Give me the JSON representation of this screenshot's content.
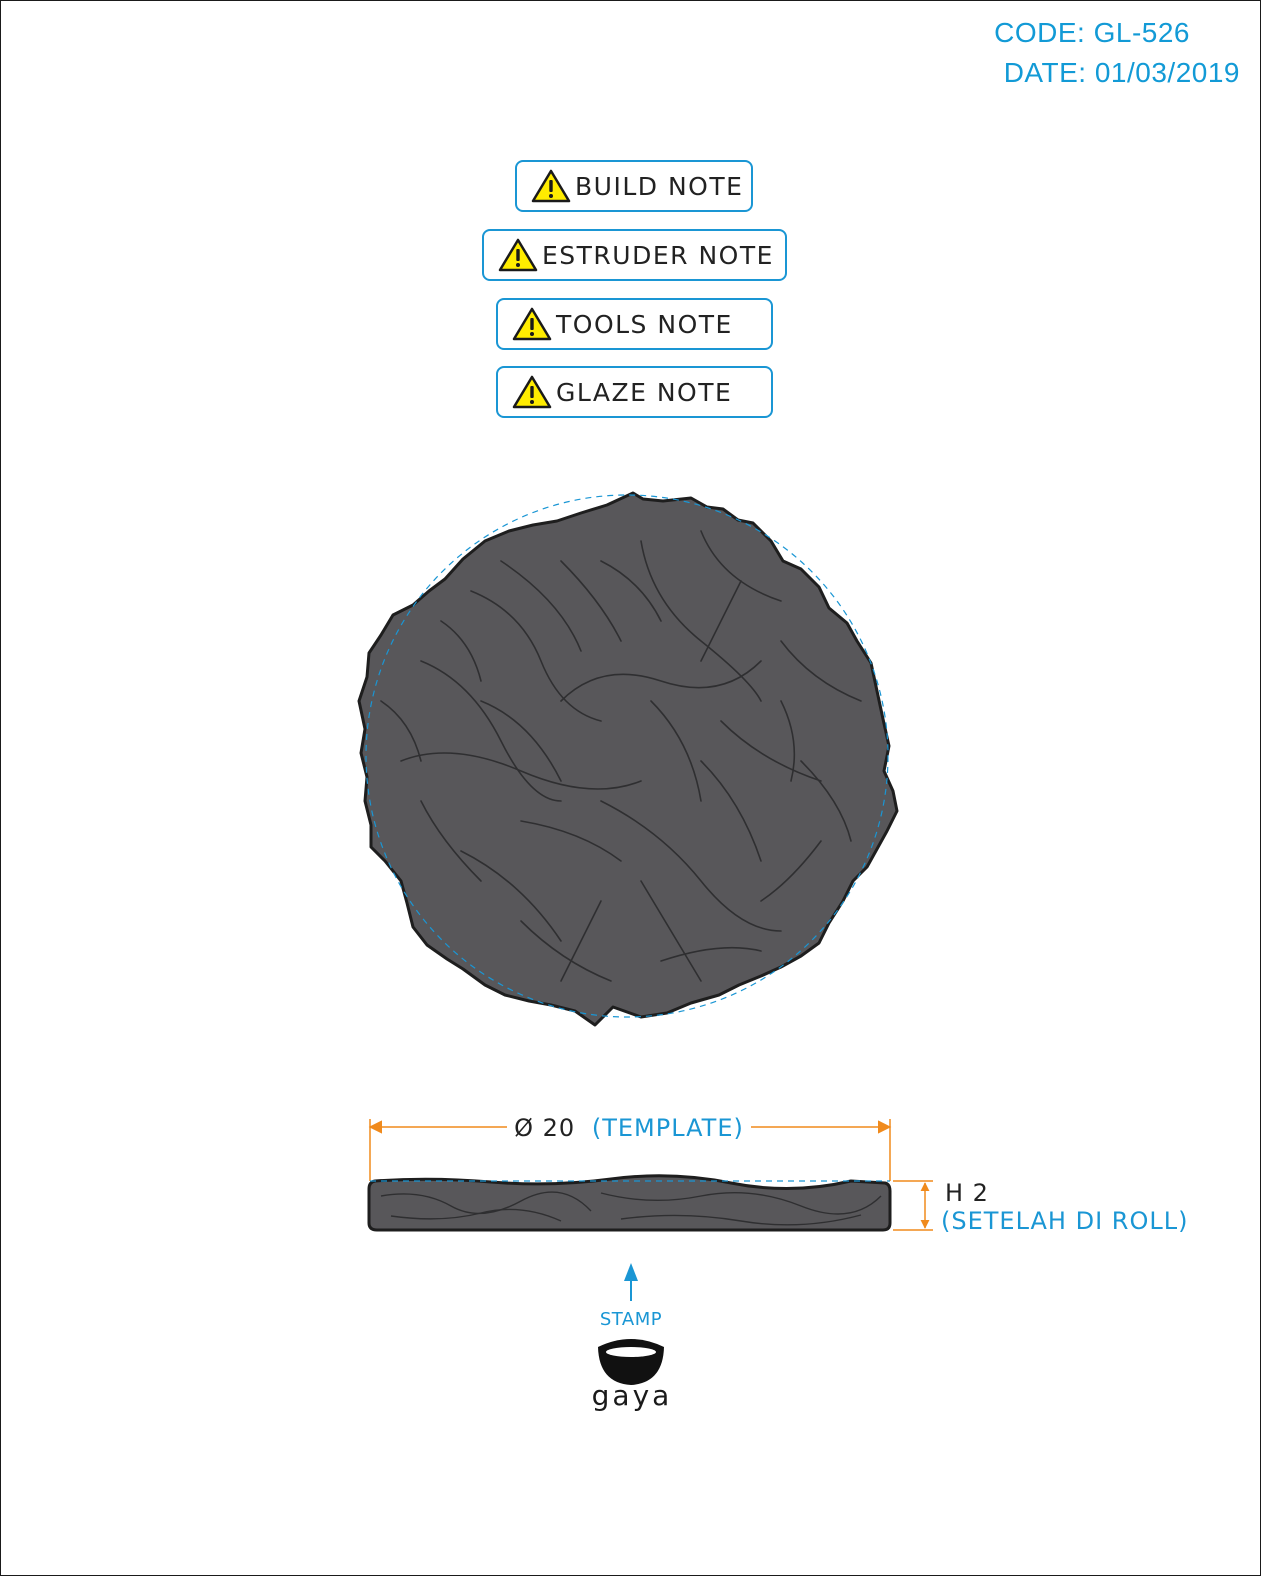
{
  "header": {
    "code": "CODE: GL-526",
    "date": "DATE: 01/03/2019"
  },
  "notes": [
    {
      "label": "BUILD NOTE",
      "icon": "warning-icon"
    },
    {
      "label": "ESTRUDER NOTE",
      "icon": "warning-icon"
    },
    {
      "label": "TOOLS NOTE",
      "icon": "warning-icon"
    },
    {
      "label": "GLAZE NOTE",
      "icon": "warning-icon"
    }
  ],
  "dimensions": {
    "diameter_value": "Ø 20",
    "diameter_note": "(TEMPLATE)",
    "height_value": "H 2",
    "height_note": "(SETELAH DI ROLL)"
  },
  "stamp": {
    "label": "STAMP",
    "brand": "gaya"
  },
  "colors": {
    "accent_blue": "#1a96d4",
    "dimension_orange": "#f08a1c",
    "product_fill": "#58575a",
    "warning_yellow": "#ffec00"
  }
}
